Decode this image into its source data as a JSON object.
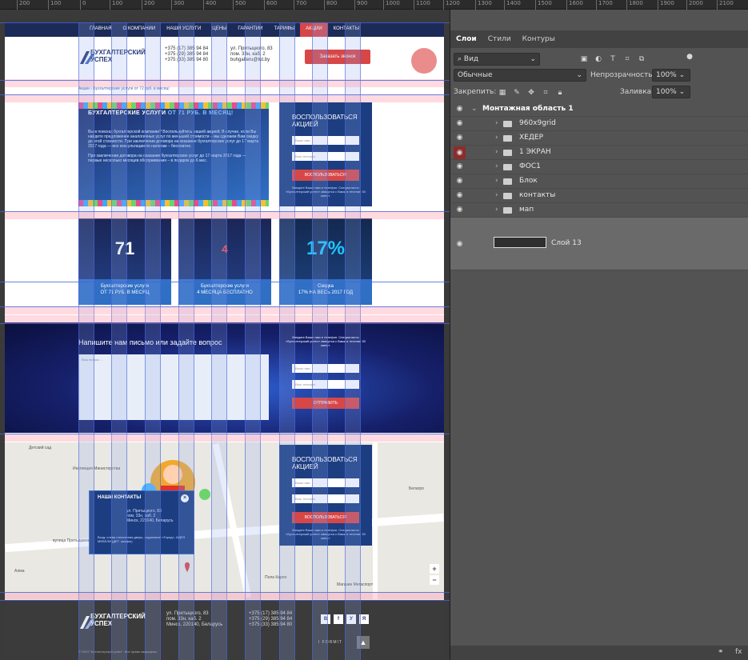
{
  "ruler": {
    "ticks": [
      "200",
      "100",
      "0",
      "100",
      "200",
      "300",
      "400",
      "500",
      "600",
      "700",
      "800",
      "900",
      "1000",
      "1100",
      "1200",
      "1300",
      "1400",
      "1500",
      "1600",
      "1700",
      "1800",
      "1900",
      "2000",
      "2100"
    ]
  },
  "site": {
    "nav": [
      "ГЛАВНАЯ",
      "О КОМПАНИИ",
      "НАШИ УСЛУГИ",
      "ЦЕНЫ",
      "ГАРАНТИИ",
      "ТАРИФЫ",
      "АКЦИИ",
      "КОНТАКТЫ"
    ],
    "nav_active": "АКЦИИ",
    "logo": "БУХГАЛТЕРСКИЙ УСПЕХ",
    "phones": [
      "+375 (17) 385 94 84",
      "+375 (29) 385 94 84",
      "+375 (33) 385 94 80"
    ],
    "address": [
      "ул. Притыцкого, 83",
      "пом. 33н, каб. 2",
      "buhgalteru@tut.by"
    ],
    "call_button": "Заказать звонок",
    "breadcrumb": "Акции › Бухгалтерские услуги от 72 руб. в месяц!",
    "promo_title_a": "БУХГАЛТЕРСКИЕ УСЛУГИ",
    "promo_title_b": "ОТ 71 РУБ. В МЕСЯЦ!",
    "promo_text_1": "Вы в поисках бухгалтерской компании? Воспользуйтесь нашей акцией. В случае, если Вы найдете предложение аналогичных услуг по меньшей стоимости – мы сделаем Вам скидку до этой стоимости. При заключении договора на оказание бухгалтерских услуг до 17 марта 2017 года — все консультации по налогам – бесплатно.",
    "promo_text_2": "При заключении договора на оказание бухгалтерских услуг до 17 марта 2017 года — первые несколько месяцев обслуживания – в подарок до 6 мес.",
    "form_title": "ВОСПОЛЬЗОВАТЬСЯ АКЦИЕЙ",
    "form_name": "Ваше имя",
    "form_phone": "Ваш телефон",
    "form_button": "ВОСПОЛЬЗОВАТЬСЯ!",
    "form_note": "Введите Ваше имя и телефон. Специалисты «Бухгалтерский успех» свяжутся с Вами в течение 30 минут.",
    "offers": [
      {
        "img": "71",
        "cap1": "Бухгалтерские услуги",
        "cap2": "ОТ 71 РУБ. В МЕСЯЦ"
      },
      {
        "img": "4",
        "cap1": "Бухгалтерские услуги",
        "cap2": "4 МЕСЯЦА БЕСПЛАТНО"
      },
      {
        "img": "17%",
        "cap1": "Скидка",
        "cap2": "17% НА ВЕСЬ 2017 ГОД"
      }
    ],
    "contact_title": "Напишите нам письмо или задайте вопрос",
    "contact_placeholder": "Ваш вопрос ...",
    "contact_note": "Введите Ваше имя и телефон. Специалисты «Бухгалтерский успех» свяжутся с Вами в течение 30 минут.",
    "contact_button": "ОТПРАВИТЬ",
    "popup_title": "НАШИ КОНТАКТЫ",
    "popup_addr": [
      "ул. Притыцкого, 83",
      "пом. 33н, каб. 2",
      "Минск, 220140, Беларусь"
    ],
    "popup_hours": "Вход: слева стеклянная дверь, подземный «Город», ИДЕЯ МЕБЕЛИ (ДЕТ. шкафы)",
    "map_labels": [
      "Детский сад",
      "Инспекция Министерства",
      "вулица Притыцкага",
      "Алма",
      "Пола Карло",
      "Магазин Мегаспорт",
      "Белагро"
    ],
    "footer_addr": [
      "ул. Притыцкого, 83",
      "пом. 33н, каб. 2",
      "Минск, 220140, Беларусь"
    ],
    "footer_phones": [
      "+375 (17) 385 94 84",
      "+375 (29) 385 94 84",
      "+375 (33) 385 94 80"
    ],
    "social": [
      "В",
      "f",
      "У",
      "Я"
    ],
    "copyright": "© ООО \"Бухгалтерский успех\". Все права защищены.",
    "made_by": "I FORMIT"
  },
  "panel": {
    "tabs": [
      "Слои",
      "Стили",
      "Контуры"
    ],
    "filter": "Вид",
    "blend": "Обычные",
    "opacity_label": "Непрозрачность:",
    "opacity": "100%",
    "lock_label": "Закрепить:",
    "fill_label": "Заливка:",
    "fill": "100%",
    "layers": [
      "Монтажная область 1",
      "960х9grid",
      "ХЕДЕР",
      "1 ЭКРАН",
      "ФОС1",
      "Блок",
      "контакты",
      "мап",
      "Слой 13"
    ]
  },
  "colors": {
    "brand": "#1c3d80",
    "accent": "#d74747",
    "panel": "#535353"
  }
}
